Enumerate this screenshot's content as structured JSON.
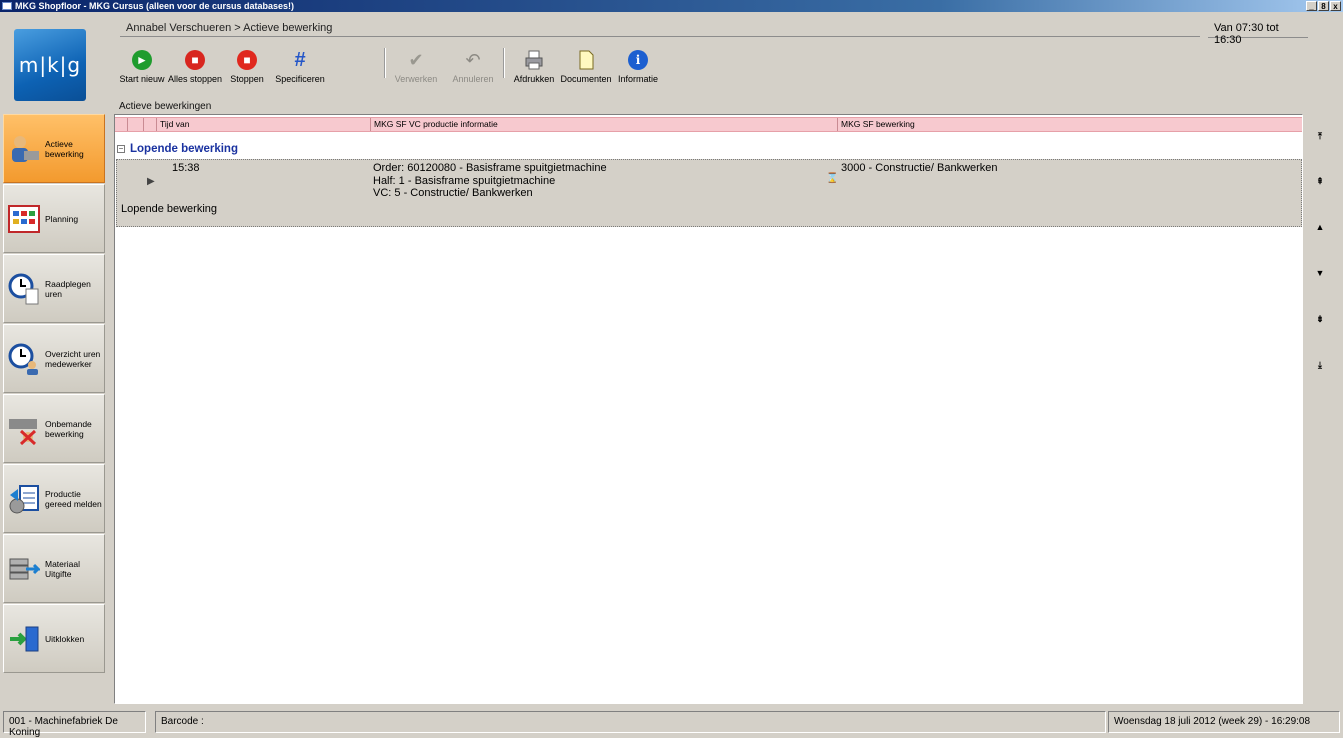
{
  "window": {
    "title": "MKG Shopfloor - MKG Cursus (alleen voor de cursus databases!)",
    "buttons": [
      "_",
      "8",
      "x"
    ]
  },
  "logo": {
    "text": "m|k|g"
  },
  "header": {
    "breadcrumb": "Annabel Verschueren > Actieve bewerking",
    "time": "Van 07:30 tot 16:30"
  },
  "toolbar": {
    "start": "Start nieuw",
    "stop_all": "Alles stoppen",
    "stop": "Stoppen",
    "specify": "Specificeren",
    "process": "Verwerken",
    "cancel": "Annuleren",
    "print": "Afdrukken",
    "documents": "Documenten",
    "info": "Informatie"
  },
  "nav": {
    "items": [
      {
        "label": "Actieve bewerking",
        "active": true
      },
      {
        "label": "Planning"
      },
      {
        "label": "Raadplegen uren"
      },
      {
        "label": "Overzicht uren medewerker"
      },
      {
        "label": "Onbemande bewerking"
      },
      {
        "label": "Productie gereed melden"
      },
      {
        "label": "Materiaal Uitgifte"
      },
      {
        "label": "Uitklokken"
      }
    ]
  },
  "main": {
    "section_title": "Actieve bewerkingen",
    "columns": [
      "Tijd van",
      "MKG SF VC productie informatie",
      "MKG SF bewerking"
    ],
    "group": {
      "expander": "−",
      "label": "Lopende bewerking"
    },
    "row": {
      "time": "15:38",
      "info_1": "Order: 60120080 - Basisframe spuitgietmachine",
      "info_2": "Half: 1 - Basisframe spuitgietmachine",
      "info_3": "VC: 5 - Constructie/ Bankwerken",
      "operation": "3000 - Constructie/ Bankwerken",
      "footer": "Lopende bewerking"
    }
  },
  "scroll": [
    "⤒",
    "⇞",
    "▲",
    "▼",
    "⇟",
    "⤓"
  ],
  "status": {
    "company": "001 - Machinefabriek De Koning",
    "barcode": "Barcode :",
    "datetime": "Woensdag 18 juli 2012 (week 29) - 16:29:08"
  },
  "colors": {
    "accent": "#f39a2e",
    "header_pink": "#f7c9cf",
    "group_blue": "#1a32a0"
  }
}
